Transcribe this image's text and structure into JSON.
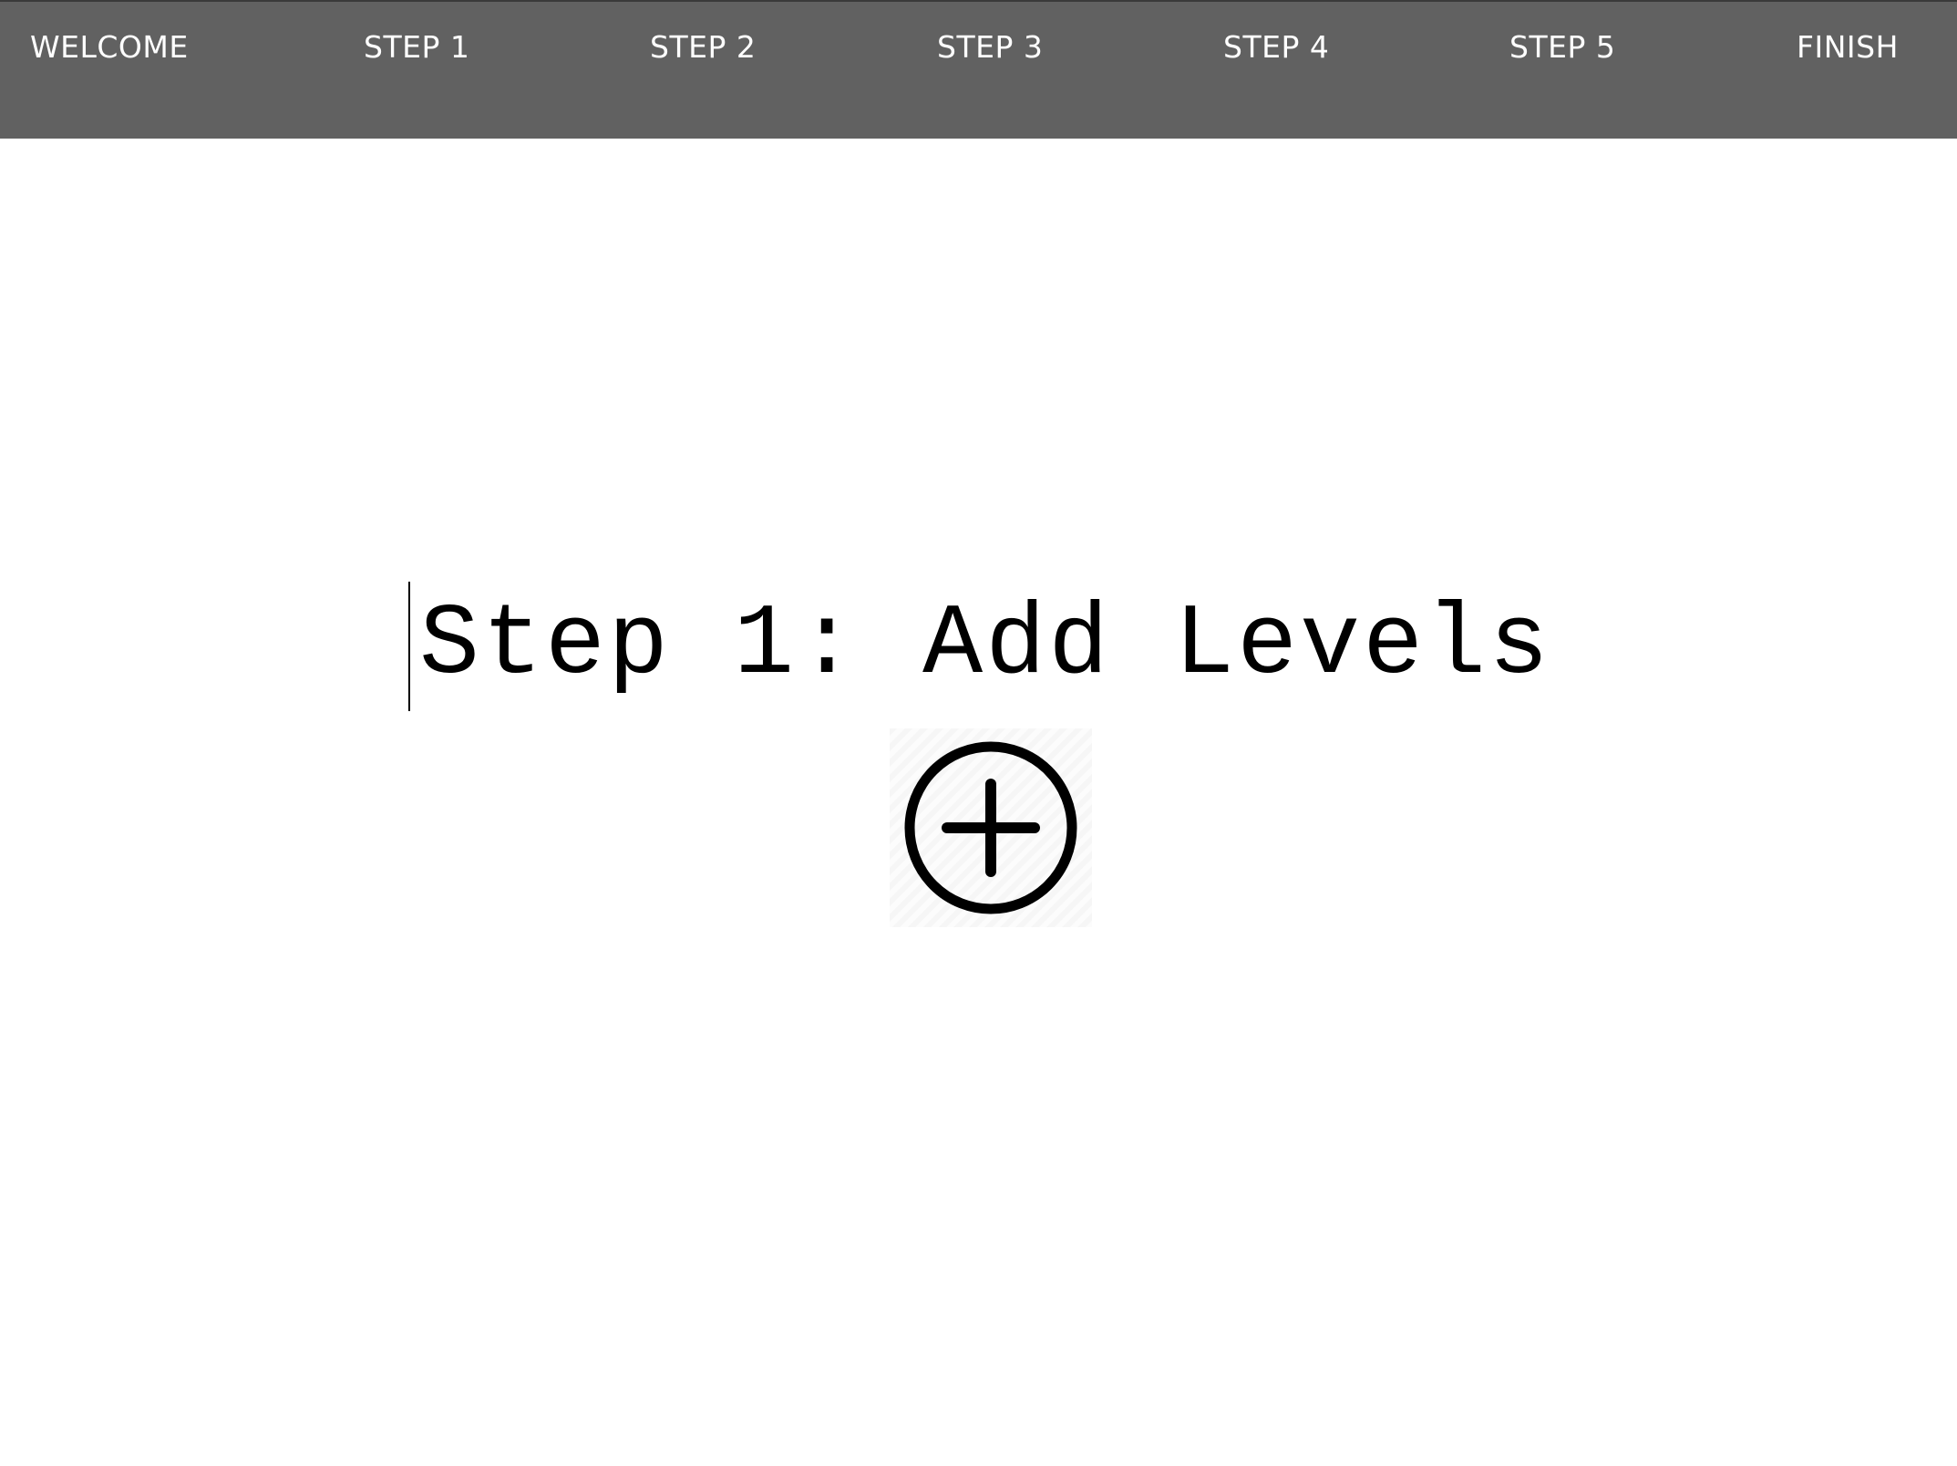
{
  "nav": {
    "items": [
      {
        "label": "WELCOME"
      },
      {
        "label": "STEP 1"
      },
      {
        "label": "STEP 2"
      },
      {
        "label": "STEP 3"
      },
      {
        "label": "STEP 4"
      },
      {
        "label": "STEP 5"
      },
      {
        "label": "FINISH"
      }
    ],
    "background_color": "#616161",
    "text_color": "#ffffff"
  },
  "main": {
    "title": "Step 1: Add Levels",
    "add_button": {
      "icon": "plus-circle-icon"
    }
  }
}
